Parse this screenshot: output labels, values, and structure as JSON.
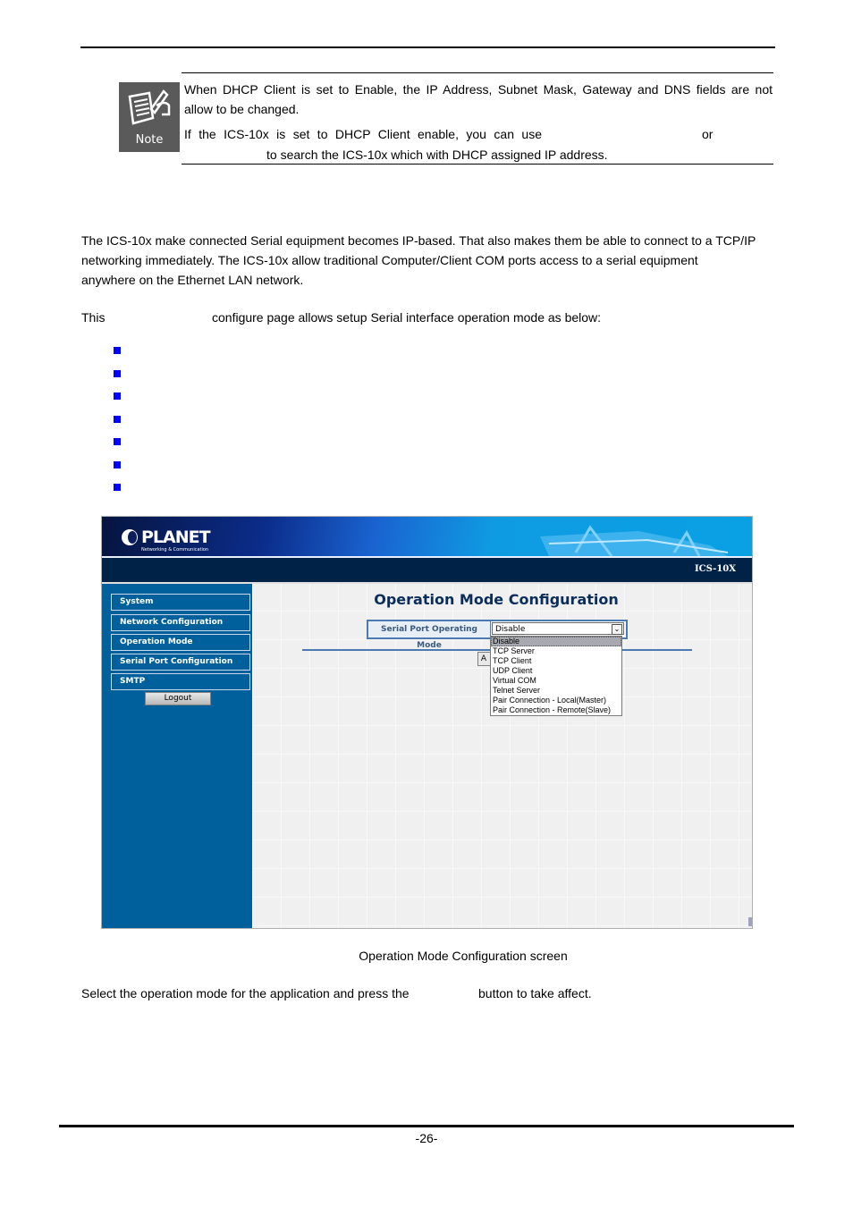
{
  "note": {
    "icon_label": "Note",
    "line1": "When DHCP Client is set to Enable, the IP Address, Subnet Mask, Gateway and DNS fields are not",
    "line2": "allow to be changed.",
    "line3_start": "If the ICS-10x is set to DHCP Client enable, you can use",
    "line3_end": "or",
    "line4": "to search the ICS-10x which with DHCP assigned IP address."
  },
  "body": {
    "para1_line1": "The ICS-10x make connected Serial equipment becomes IP-based. That also makes them be able to connect to a TCP/IP",
    "para1_line2": "networking immediately. The ICS-10x allow traditional Computer/Client COM ports access to a serial equipment",
    "para1_line3": "anywhere on the Ethernet LAN network.",
    "para2_start": "This",
    "para2_end": "configure page allows setup Serial interface operation mode as below:",
    "bullet_count": 7
  },
  "screenshot": {
    "brand": "PLANET",
    "brand_tagline": "Networking & Communication",
    "model": "ICS-10X",
    "sidebar": {
      "items": [
        {
          "label": "System"
        },
        {
          "label": "Network Configuration"
        },
        {
          "label": "Operation Mode"
        },
        {
          "label": "Serial Port Configuration"
        },
        {
          "label": "SMTP"
        }
      ],
      "logout_label": "Logout"
    },
    "title": "Operation Mode Configuration",
    "field_label": "Serial Port Operating Mode",
    "selected_value": "Disable",
    "apply_partial": "A",
    "options": [
      "Disable",
      "TCP Server",
      "TCP Client",
      "UDP Client",
      "Virtual COM",
      "Telnet Server",
      "Pair Connection - Local(Master)",
      "Pair Connection - Remote(Slave)"
    ],
    "highlighted_option": "Disable"
  },
  "caption": "Operation Mode Configuration screen",
  "instruction_start": "Select the operation mode for the application and press the",
  "instruction_end": "button to take affect.",
  "footer": {
    "page_number": "-26-"
  },
  "colors": {
    "bullet": "#0000ff",
    "sidebar_bg": "#00609c",
    "navbar_bg": "#002246",
    "title_color": "#0b2d5a"
  }
}
